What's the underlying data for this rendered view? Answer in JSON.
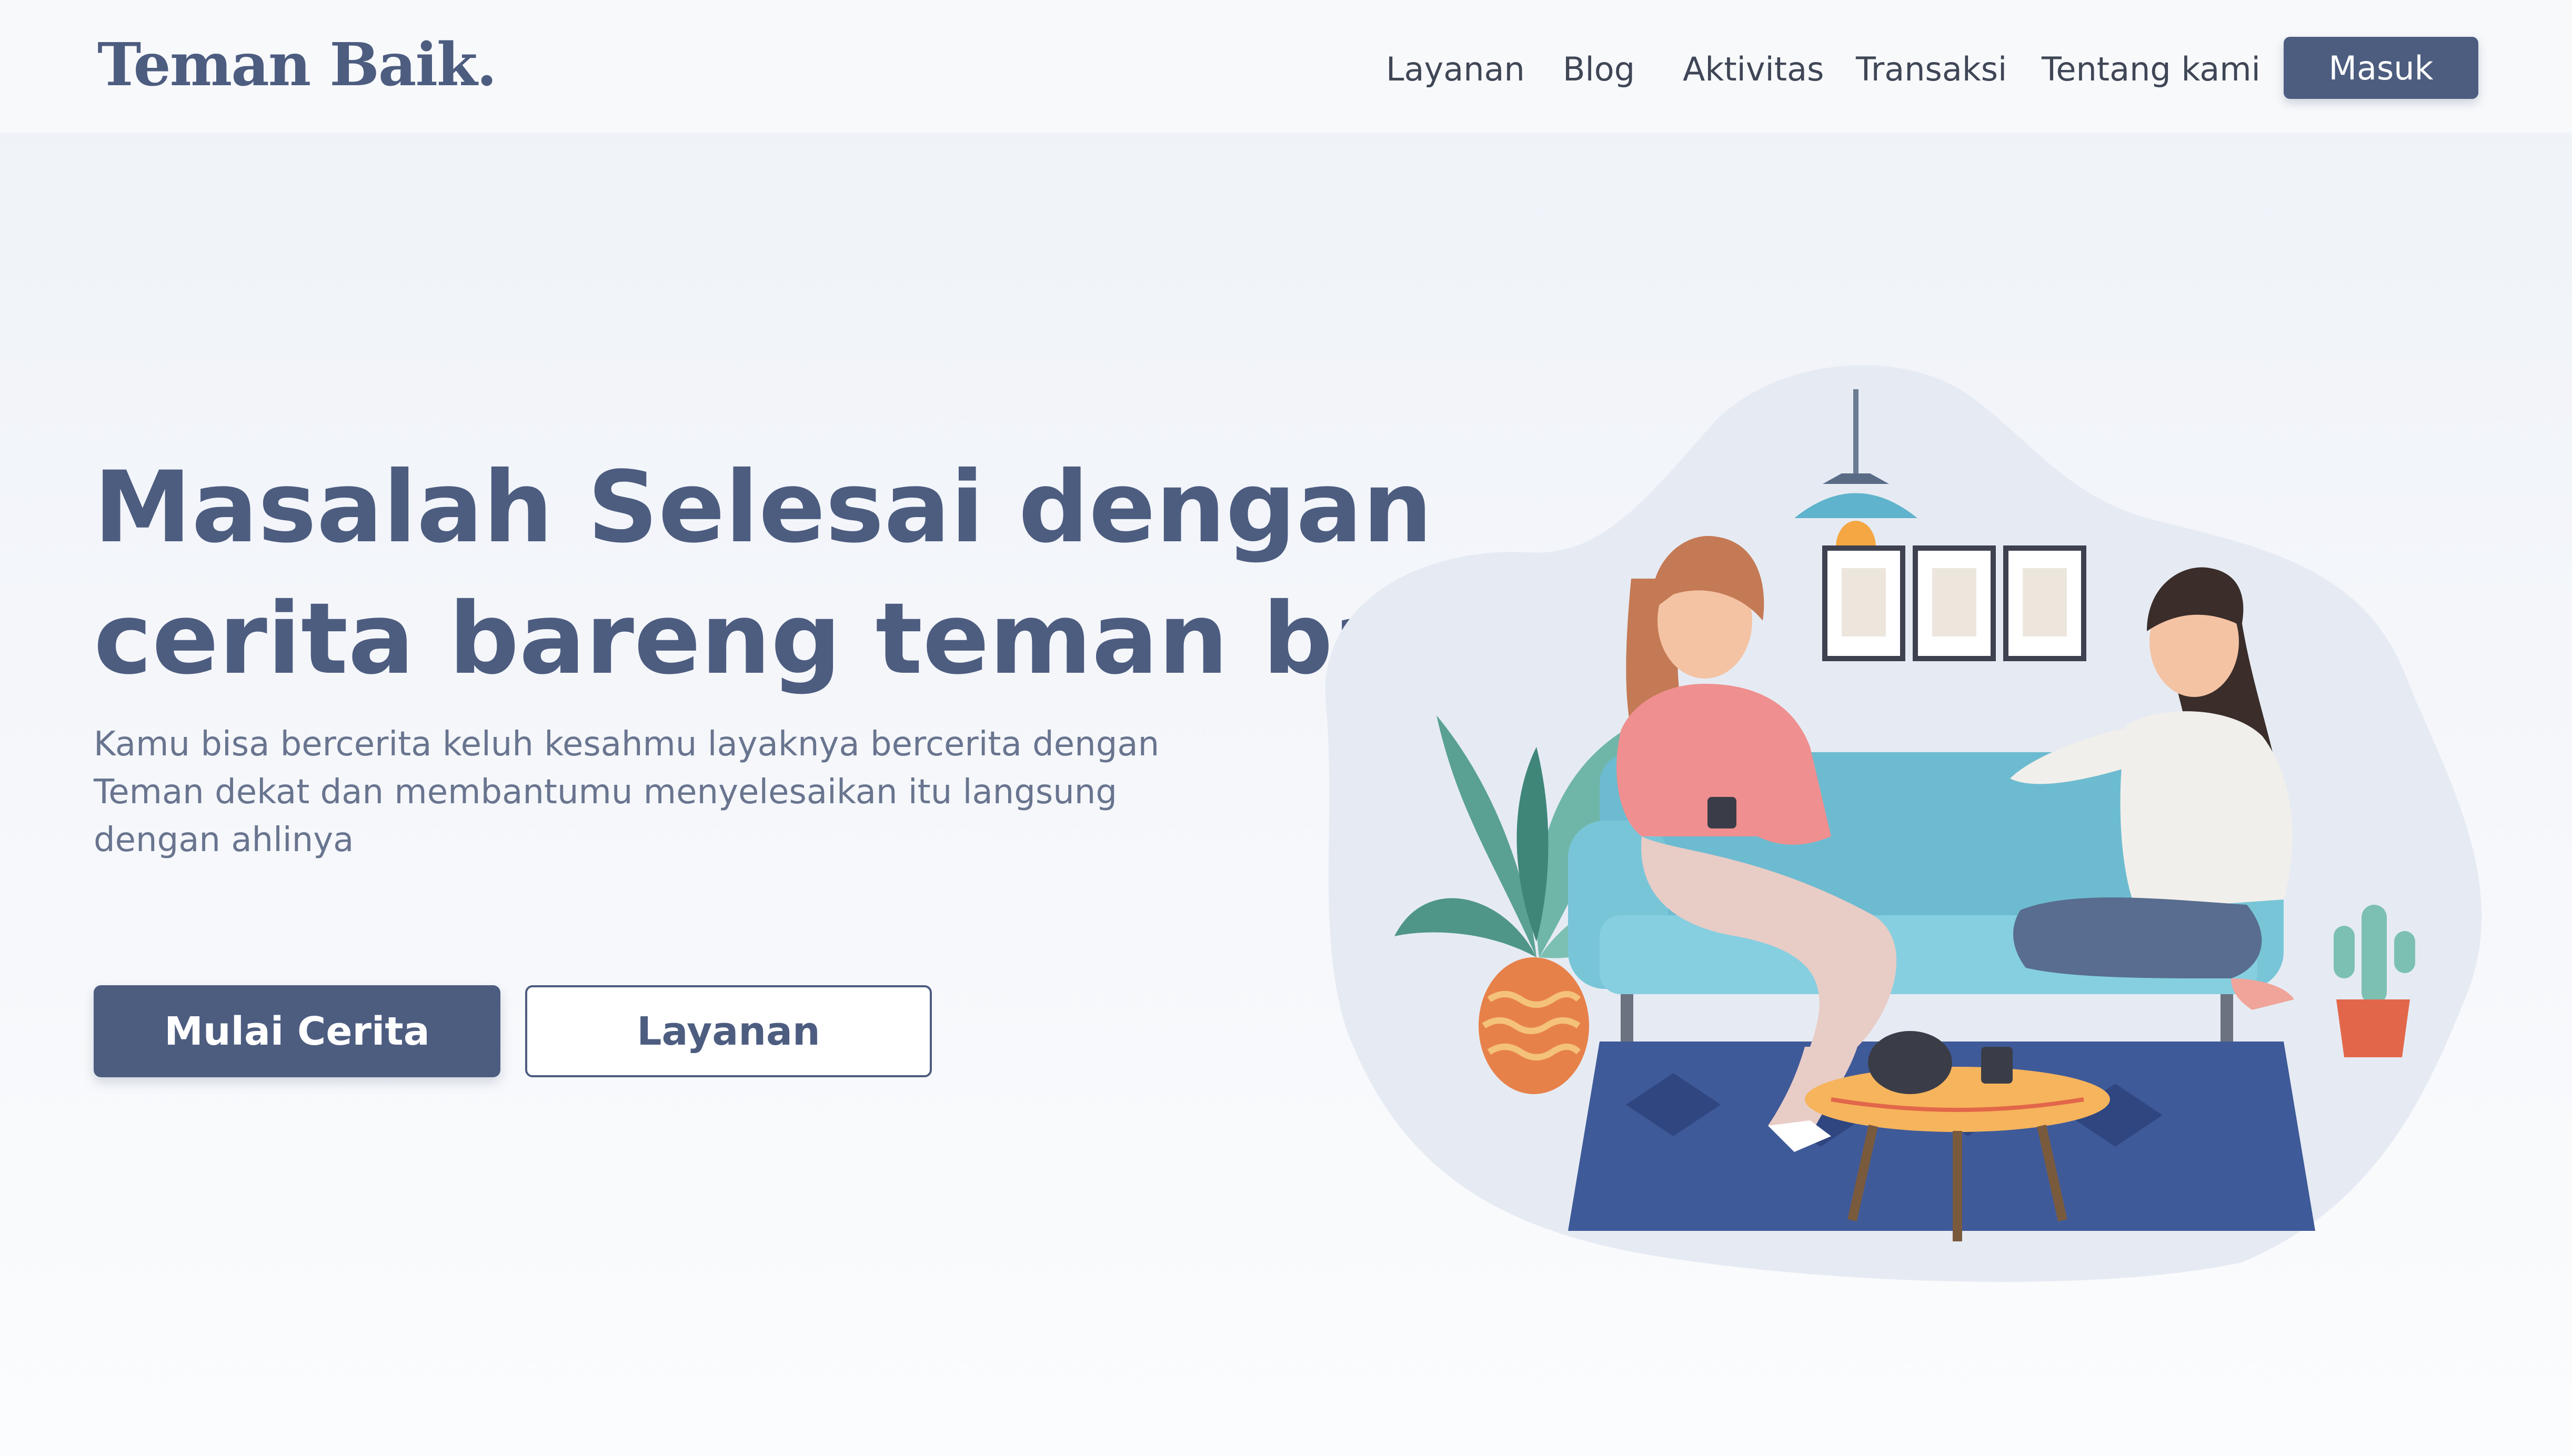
{
  "header": {
    "logo": "Teman Baik.",
    "nav": [
      "Layanan",
      "Blog",
      "Aktivitas",
      "Transaksi",
      "Tentang kami"
    ],
    "login_label": "Masuk"
  },
  "hero": {
    "title_line1": "Masalah Selesai dengan",
    "title_line2": "cerita bareng teman baik",
    "subtitle": "Kamu bisa bercerita keluh kesahmu layaknya bercerita dengan Teman dekat dan membantumu menyelesaikan itu langsung dengan ahlinya",
    "primary_cta": "Mulai Cerita",
    "secondary_cta": "Layanan"
  },
  "colors": {
    "brand": "#4d5d80",
    "nav_text": "#3f4656",
    "sofa": "#79c5d8",
    "rug": "#3f5a99"
  }
}
